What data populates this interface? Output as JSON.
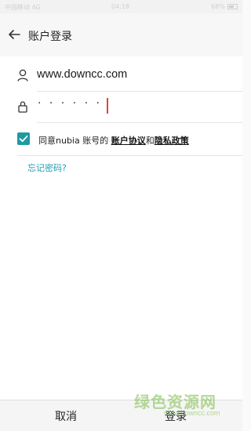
{
  "status_bar": {
    "carrier": "中国移动 4G",
    "time": "04:18",
    "battery": "68%"
  },
  "header": {
    "title": "账户登录"
  },
  "form": {
    "account_value": "www.downcc.com",
    "password_mask": "· · · · · ·",
    "agree_prefix": "同意nubia 账号的 ",
    "agreement_link": "账户协议",
    "agree_and": "和",
    "privacy_link": "隐私政策",
    "forgot_link": "忘记密码?"
  },
  "bottom_bar": {
    "cancel_label": "取消",
    "login_label": "登录"
  },
  "watermark": {
    "text_cn": "绿色资源网",
    "text_en": "www.downcc.com"
  },
  "colors": {
    "accent": "#1e9aa2",
    "link": "#1f9fb0",
    "caret": "#d9463b"
  }
}
